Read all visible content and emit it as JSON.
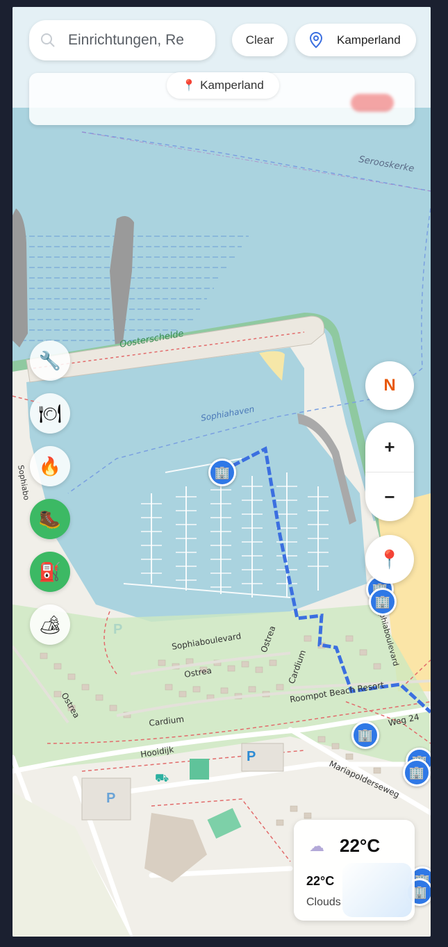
{
  "search": {
    "placeholder": "Einrichtungen, Re"
  },
  "clear_label": "Clear",
  "location": {
    "label": "Kamperland"
  },
  "chip": {
    "label": "Kamperland"
  },
  "categories": [
    {
      "icon": "tools-icon",
      "glyph": "🔧",
      "active": false
    },
    {
      "icon": "restaurant-icon",
      "glyph": "🍽",
      "active": false
    },
    {
      "icon": "fire-icon",
      "glyph": "🔥",
      "active": false
    },
    {
      "icon": "hiking-boot-icon",
      "glyph": "🥾",
      "active": true
    },
    {
      "icon": "fuel-pump-icon",
      "glyph": "⛽",
      "active": true
    },
    {
      "icon": "camping-icon",
      "glyph": "🏕",
      "active": false
    }
  ],
  "compass_label": "N",
  "zoom": {
    "in": "+",
    "out": "−"
  },
  "weather": {
    "temp_main": "22°C",
    "temp_sub": "22°C",
    "description": "Clouds"
  },
  "map_labels": {
    "oosterschelde": "Oosterschelde",
    "serooskerke": "Serooskerke",
    "sophiahaven": "Sophiahaven",
    "sophiaboulevard": "Sophiaboulevard",
    "ostrea": "Ostrea",
    "cardium": "Cardium",
    "roompot": "Roompot Beach Resort",
    "weg24": "Weg 24",
    "hooidijk": "Hooidijk",
    "mariapolderseweg": "Mariapolderseweg",
    "sophiaboulevard_vert": "Sophiaboulevard",
    "sophiabo": "Sophiabo"
  },
  "colors": {
    "water": "#aad3df",
    "route": "#3b6fe0",
    "marker": "#2f78e6",
    "accent": "#e8590c",
    "active": "#3cb964"
  }
}
